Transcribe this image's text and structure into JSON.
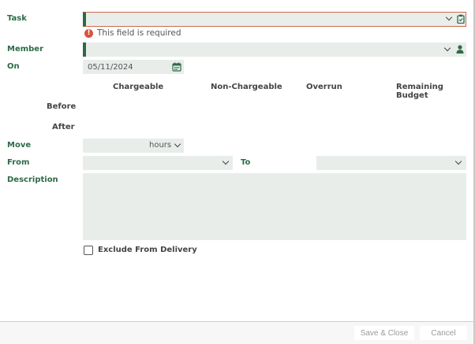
{
  "form": {
    "task": {
      "label": "Task",
      "value": "",
      "error": "This field is required"
    },
    "member": {
      "label": "Member",
      "value": ""
    },
    "on": {
      "label": "On",
      "value": "05/11/2024"
    },
    "budget": {
      "columns": [
        "Chargeable",
        "Non-Chargeable",
        "Overrun",
        "Remaining Budget"
      ],
      "rows": [
        "Before",
        "After"
      ]
    },
    "move": {
      "label": "Move",
      "value": "",
      "unit": "hours"
    },
    "from": {
      "label": "From",
      "value": ""
    },
    "to": {
      "label": "To",
      "value": ""
    },
    "description": {
      "label": "Description",
      "value": ""
    },
    "exclude": {
      "label": "Exclude From Delivery",
      "checked": false
    }
  },
  "footer": {
    "save_label": "Save & Close",
    "cancel_label": "Cancel"
  },
  "colors": {
    "accent": "#2d6a47",
    "error": "#d9533b",
    "field_bg": "#e8edea"
  },
  "icons": {
    "task": "clipboard-icon",
    "member": "person-icon",
    "date": "calendar-icon",
    "error": "exclamation-circle-icon"
  }
}
